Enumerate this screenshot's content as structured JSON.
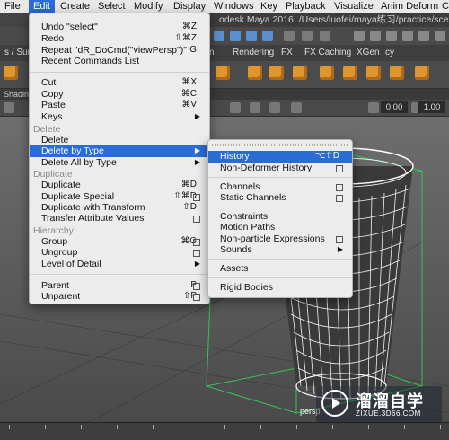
{
  "menubar": [
    "File",
    "Edit",
    "Create",
    "Select",
    "Modify",
    "Display",
    "Windows",
    "Key",
    "Playback",
    "Visualize",
    "Anim Deform",
    "C"
  ],
  "title": "odesk Maya 2016: /Users/luofei/maya练习/practice/scenes/lajit",
  "shelf_tabs": [
    "s / Surfa",
    "n",
    "Rendering",
    "FX",
    "FX Caching",
    "XGen",
    "cy"
  ],
  "panel_label": "Shadin",
  "view_values": [
    "0.00",
    "1.00"
  ],
  "viewport_label": "persp",
  "edit_menu": {
    "items": [
      {
        "label": "Undo \"select\"",
        "shortcut": "⌘Z"
      },
      {
        "label": "Redo",
        "shortcut": "⇧⌘Z"
      },
      {
        "label": "Repeat \"dR_DoCmd(\"viewPersp\")\"",
        "shortcut": "G"
      },
      {
        "label": "Recent Commands List",
        "shortcut": ""
      },
      {
        "label": "Cut",
        "shortcut": "⌘X"
      },
      {
        "label": "Copy",
        "shortcut": "⌘C"
      },
      {
        "label": "Paste",
        "shortcut": "⌘V"
      },
      {
        "label": "Keys",
        "shortcut": ""
      }
    ],
    "section_delete": "Delete",
    "delete_items": [
      {
        "label": "Delete",
        "shortcut": ""
      },
      {
        "label": "Delete by Type",
        "shortcut": ""
      },
      {
        "label": "Delete All by Type",
        "shortcut": ""
      }
    ],
    "section_duplicate": "Duplicate",
    "duplicate_items": [
      {
        "label": "Duplicate",
        "shortcut": "⌘D"
      },
      {
        "label": "Duplicate Special",
        "shortcut": "⇧⌘D"
      },
      {
        "label": "Duplicate with Transform",
        "shortcut": "⇧D"
      },
      {
        "label": "Transfer Attribute Values",
        "shortcut": ""
      }
    ],
    "section_hierarchy": "Hierarchy",
    "hierarchy_items": [
      {
        "label": "Group",
        "shortcut": "⌘G"
      },
      {
        "label": "Ungroup",
        "shortcut": ""
      },
      {
        "label": "Level of Detail",
        "shortcut": ""
      },
      {
        "label": "Parent",
        "shortcut": "P"
      },
      {
        "label": "Unparent",
        "shortcut": "⇧P"
      }
    ]
  },
  "submenu": {
    "items": [
      {
        "label": "History",
        "shortcut": "⌥⇧D"
      },
      {
        "label": "Non-Deformer History",
        "shortcut": ""
      },
      {
        "label": "Channels",
        "shortcut": ""
      },
      {
        "label": "Static Channels",
        "shortcut": ""
      },
      {
        "label": "Constraints",
        "shortcut": ""
      },
      {
        "label": "Motion Paths",
        "shortcut": ""
      },
      {
        "label": "Non-particle Expressions",
        "shortcut": ""
      },
      {
        "label": "Sounds",
        "shortcut": ""
      },
      {
        "label": "Assets",
        "shortcut": ""
      },
      {
        "label": "Rigid Bodies",
        "shortcut": ""
      }
    ]
  },
  "watermark": {
    "cn": "溜溜自学",
    "en": "ZIXUE.3D66.COM"
  },
  "colors": {
    "highlight": "#2a6bd6",
    "menu_bg": "#ececec",
    "wire": "#ffffff",
    "grid_green": "#36c25a"
  }
}
